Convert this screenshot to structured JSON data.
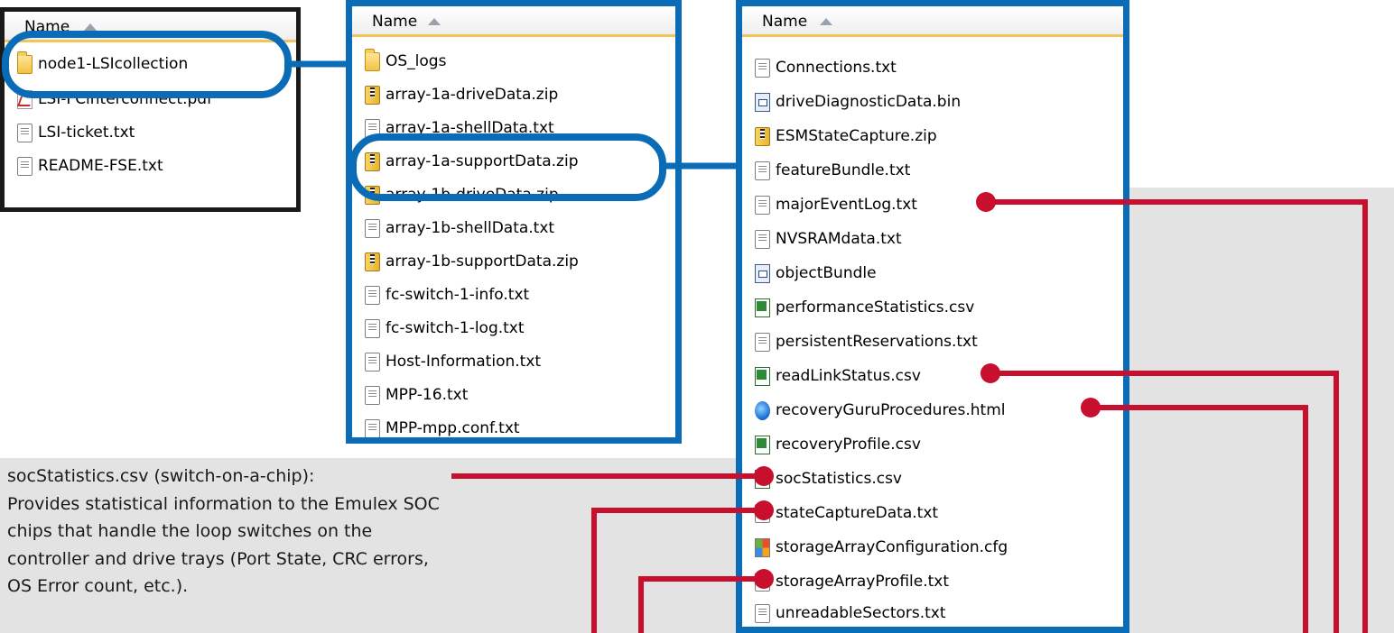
{
  "panels": [
    {
      "id": "panel-1",
      "header": "Name",
      "items": [
        {
          "name": "node1-LSIcollection",
          "icon": "folder-icon"
        },
        {
          "name": "LSI-FCinterconnect.pdf",
          "icon": "pdf-icon"
        },
        {
          "name": "LSI-ticket.txt",
          "icon": "text-file-icon"
        },
        {
          "name": "README-FSE.txt",
          "icon": "text-file-icon"
        }
      ]
    },
    {
      "id": "panel-2",
      "header": "Name",
      "items": [
        {
          "name": "OS_logs",
          "icon": "folder-icon"
        },
        {
          "name": "array-1a-driveData.zip",
          "icon": "zip-icon"
        },
        {
          "name": "array-1a-shellData.txt",
          "icon": "text-file-icon"
        },
        {
          "name": "array-1a-supportData.zip",
          "icon": "zip-icon"
        },
        {
          "name": "array-1b-driveData.zip",
          "icon": "zip-icon"
        },
        {
          "name": "array-1b-shellData.txt",
          "icon": "text-file-icon"
        },
        {
          "name": "array-1b-supportData.zip",
          "icon": "zip-icon"
        },
        {
          "name": "fc-switch-1-info.txt",
          "icon": "text-file-icon"
        },
        {
          "name": "fc-switch-1-log.txt",
          "icon": "text-file-icon"
        },
        {
          "name": "Host-Information.txt",
          "icon": "text-file-icon"
        },
        {
          "name": "MPP-16.txt",
          "icon": "text-file-icon"
        },
        {
          "name": "MPP-mpp.conf.txt",
          "icon": "text-file-icon"
        }
      ]
    },
    {
      "id": "panel-3",
      "header": "Name",
      "items": [
        {
          "name": "Connections.txt",
          "icon": "text-file-icon"
        },
        {
          "name": "driveDiagnosticData.bin",
          "icon": "binary-file-icon"
        },
        {
          "name": "ESMStateCapture.zip",
          "icon": "zip-icon"
        },
        {
          "name": "featureBundle.txt",
          "icon": "text-file-icon"
        },
        {
          "name": "majorEventLog.txt",
          "icon": "text-file-icon"
        },
        {
          "name": "NVSRAMdata.txt",
          "icon": "text-file-icon"
        },
        {
          "name": "objectBundle",
          "icon": "binary-file-icon"
        },
        {
          "name": "performanceStatistics.csv",
          "icon": "csv-icon"
        },
        {
          "name": "persistentReservations.txt",
          "icon": "text-file-icon"
        },
        {
          "name": "readLinkStatus.csv",
          "icon": "csv-icon"
        },
        {
          "name": "recoveryGuruProcedures.html",
          "icon": "html-icon"
        },
        {
          "name": "recoveryProfile.csv",
          "icon": "csv-icon"
        },
        {
          "name": "socStatistics.csv",
          "icon": "csv-icon"
        },
        {
          "name": "stateCaptureData.txt",
          "icon": "text-file-icon"
        },
        {
          "name": "storageArrayConfiguration.cfg",
          "icon": "config-icon"
        },
        {
          "name": "storageArrayProfile.txt",
          "icon": "text-file-icon"
        },
        {
          "name": "unreadableSectors.txt",
          "icon": "text-file-icon"
        }
      ]
    }
  ],
  "annotation": {
    "title": "socStatistics.csv (switch-on-a-chip):",
    "lines": [
      "Provides statistical information to the Emulex SOC",
      "chips that handle the loop switches on the",
      "controller and drive trays (Port State, CRC errors,",
      "OS Error count, etc.)."
    ]
  },
  "colors": {
    "panel_border_blue": "#0a6cb6",
    "panel_border_black": "#1a1a1a",
    "connector_red": "#c8102e",
    "background_gray": "#e3e3e3",
    "header_underline": "#f2c45c"
  }
}
